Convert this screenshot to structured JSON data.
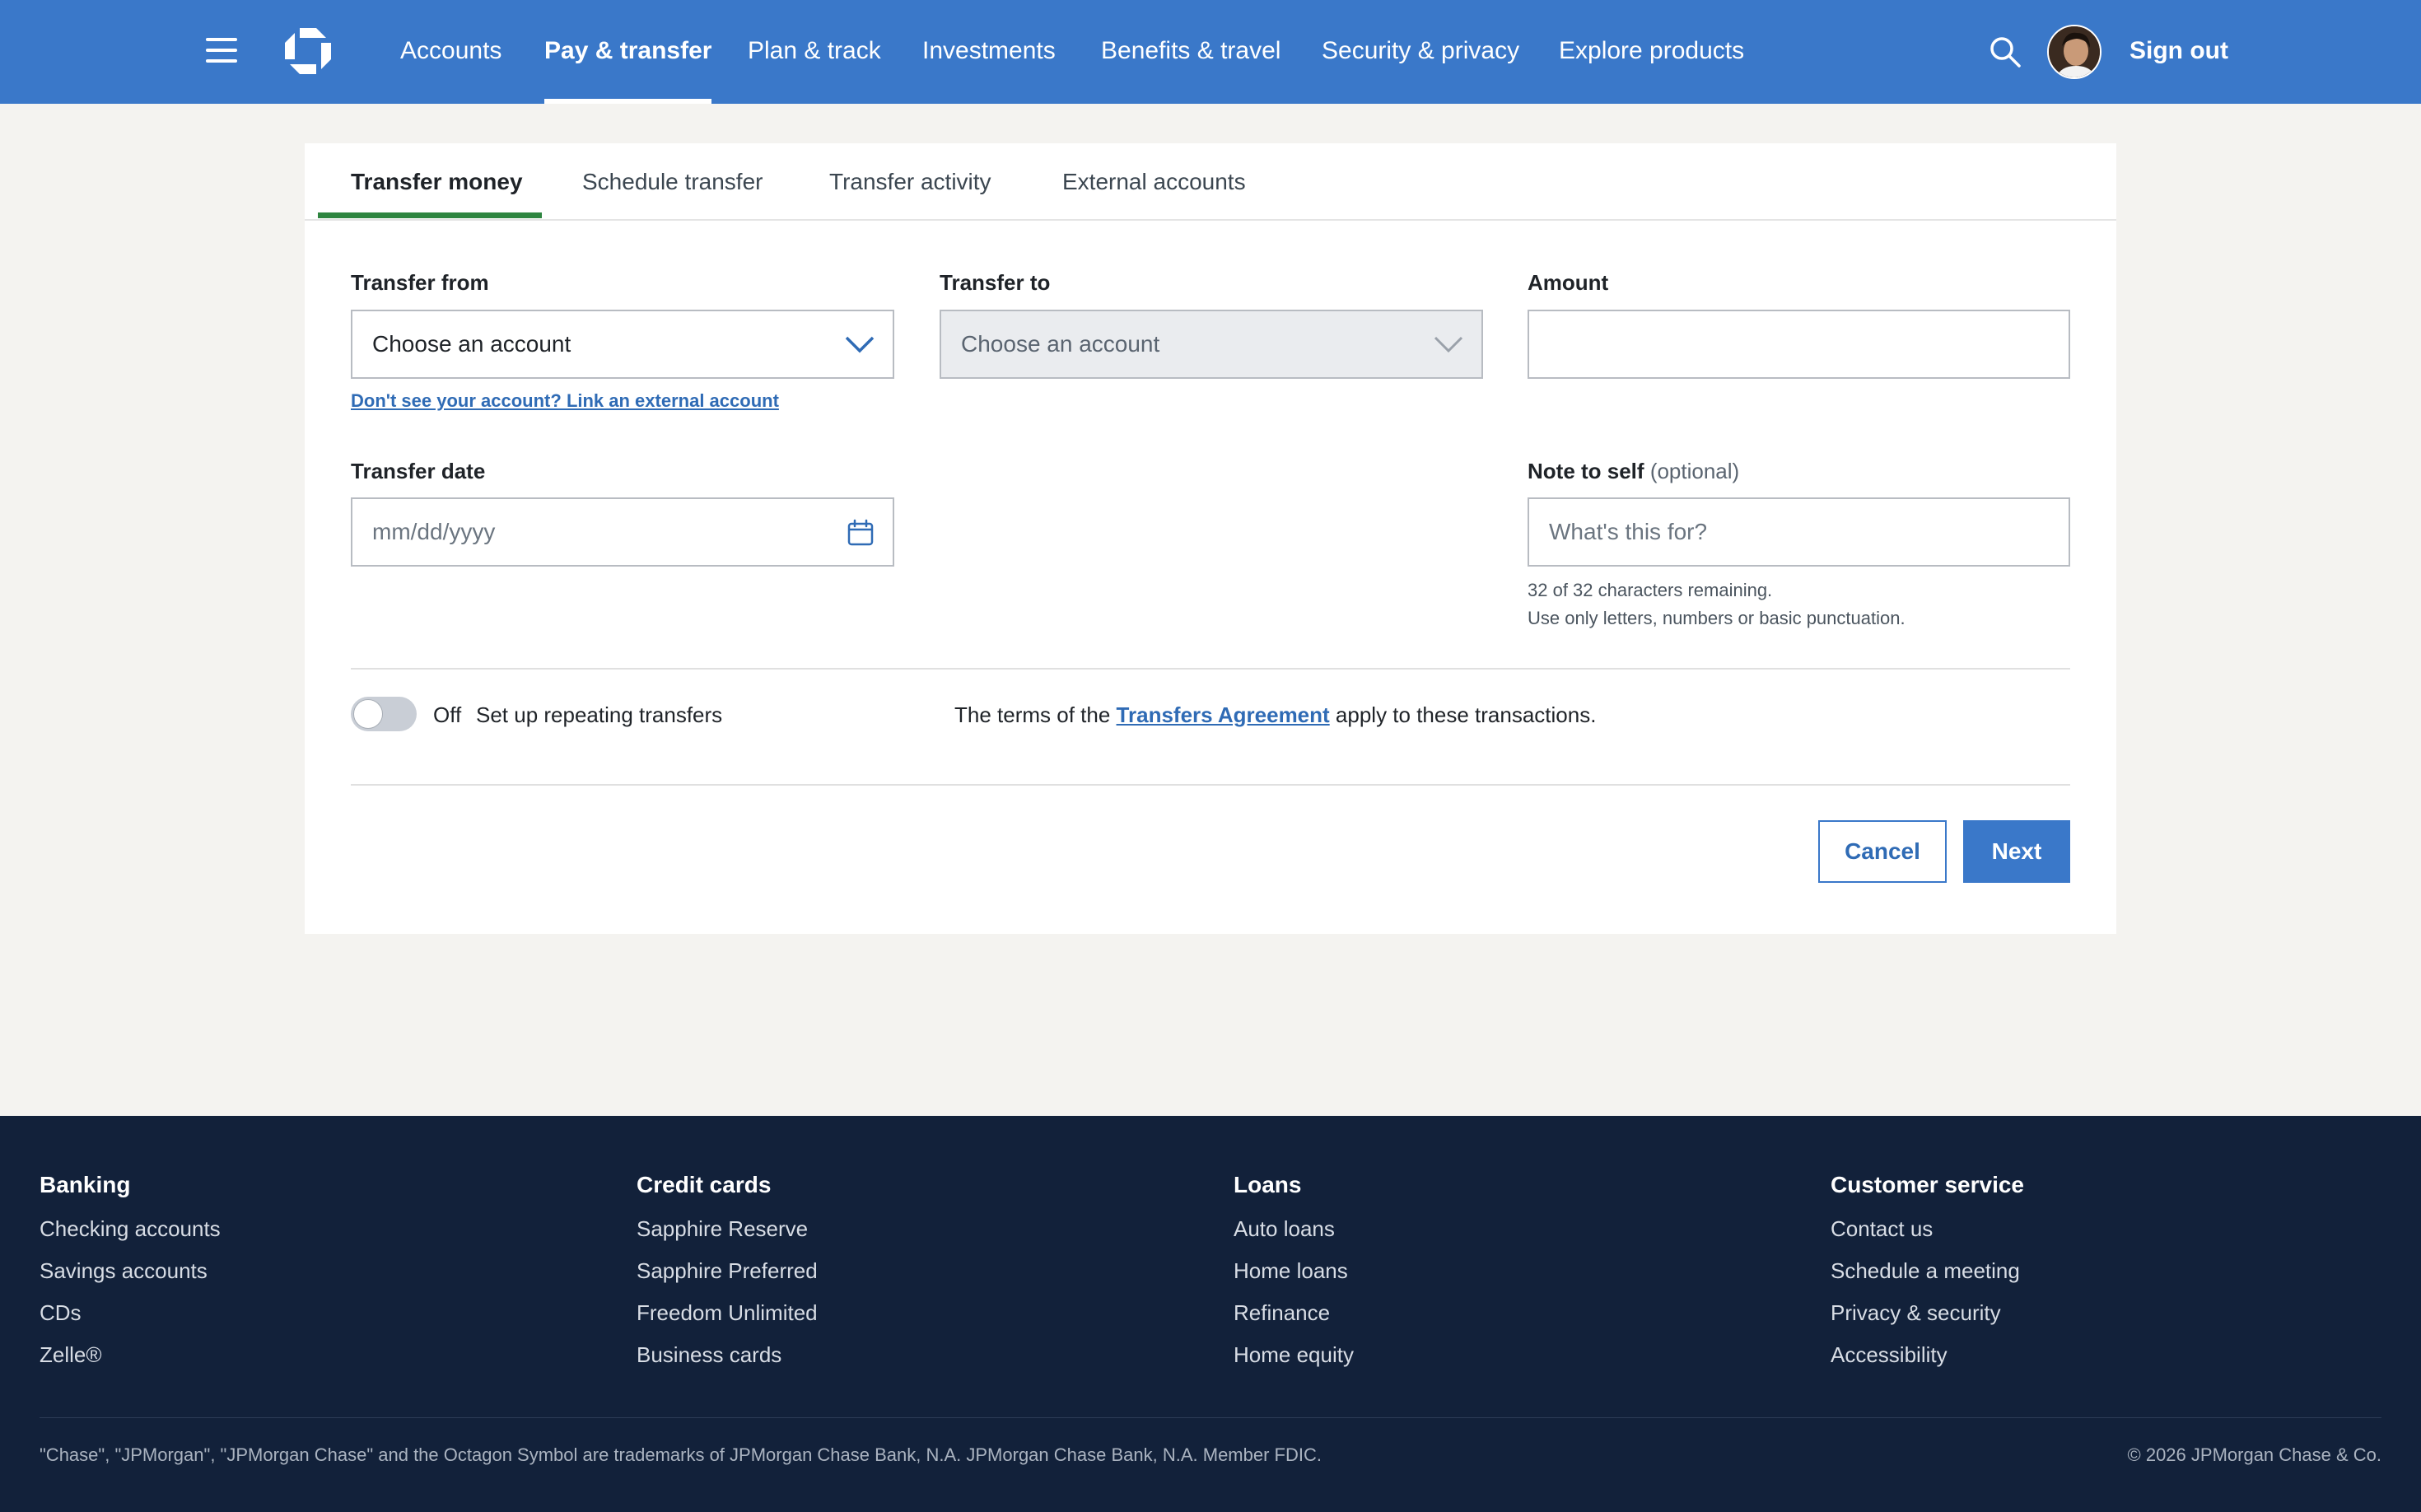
{
  "nav": {
    "items": [
      "Accounts",
      "Pay & transfer",
      "Plan & track",
      "Investments",
      "Benefits & travel",
      "Security & privacy",
      "Explore products"
    ],
    "active": "Pay & transfer",
    "sign_out": "Sign out",
    "icons": {
      "menu": "hamburger-menu-icon",
      "logo": "chase-octagon-logo",
      "search": "search-icon",
      "avatar": "user-avatar"
    }
  },
  "tabs": {
    "items": [
      "Transfer money",
      "Schedule transfer",
      "Transfer activity",
      "External accounts"
    ],
    "active": "Transfer money"
  },
  "form": {
    "transfer_from": {
      "label": "Transfer from",
      "placeholder": "Choose an account"
    },
    "link_external": "Don't see your account? Link an external account",
    "transfer_to": {
      "label": "Transfer to",
      "placeholder": "Choose an account"
    },
    "amount": {
      "label": "Amount",
      "value": ""
    },
    "transfer_date": {
      "label": "Transfer date",
      "placeholder": "mm/dd/yyyy"
    },
    "note": {
      "label": "Note to self",
      "optional": "(optional)",
      "placeholder": "What's this for?",
      "remaining": "32 of 32 characters remaining.",
      "rules": "Use only letters, numbers or basic punctuation."
    },
    "repeat": {
      "state": "Off",
      "label": "Set up repeating transfers"
    },
    "terms": {
      "before": "The terms of the",
      "link": "Transfers Agreement",
      "after": "apply to these transactions."
    },
    "cancel": "Cancel",
    "next": "Next"
  },
  "footer": {
    "columns": [
      {
        "heading": "Banking",
        "links": [
          "Checking accounts",
          "Savings accounts",
          "CDs",
          "Zelle®"
        ]
      },
      {
        "heading": "Credit cards",
        "links": [
          "Sapphire Reserve",
          "Sapphire Preferred",
          "Freedom Unlimited",
          "Business cards"
        ]
      },
      {
        "heading": "Loans",
        "links": [
          "Auto loans",
          "Home loans",
          "Refinance",
          "Home equity"
        ]
      },
      {
        "heading": "Customer service",
        "links": [
          "Contact us",
          "Schedule a meeting",
          "Privacy & security",
          "Accessibility"
        ]
      }
    ],
    "legal": "\"Chase\", \"JPMorgan\", \"JPMorgan Chase\" and the Octagon Symbol are trademarks of JPMorgan Chase Bank, N.A. JPMorgan Chase Bank, N.A. Member FDIC.",
    "copyright": "© 2026 JPMorgan Chase & Co."
  },
  "colors": {
    "brand_blue": "#3a78c9",
    "tab_accent": "#2e8540",
    "footer_bg": "#12213a",
    "page_bg": "#f4f3f0"
  }
}
